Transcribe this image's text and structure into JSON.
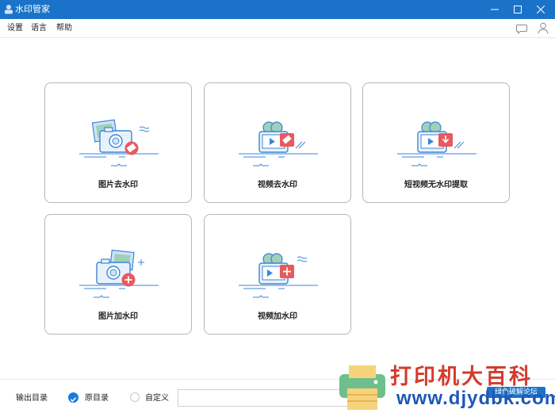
{
  "window": {
    "title": "水印管家"
  },
  "menu": {
    "settings": "设置",
    "language": "语言",
    "help": "帮助"
  },
  "cards": [
    {
      "label": "图片去水印",
      "icon": "image-remove-watermark-icon"
    },
    {
      "label": "视频去水印",
      "icon": "video-remove-watermark-icon"
    },
    {
      "label": "短视频无水印提取",
      "icon": "short-video-extract-icon"
    },
    {
      "label": "图片加水印",
      "icon": "image-add-watermark-icon"
    },
    {
      "label": "视频加水印",
      "icon": "video-add-watermark-icon"
    }
  ],
  "output": {
    "label": "输出目录",
    "option_original": "原目录",
    "option_custom": "自定义",
    "selected": "原目录",
    "path_value": ""
  },
  "watermark": {
    "line1": "打印机大百科",
    "line2": "www.djydbk.com",
    "tag": "绿色破解论坛"
  },
  "colors": {
    "titlebar": "#1a73c9",
    "accent_blue": "#1a7be0",
    "icon_blue": "#3b86d6",
    "icon_light": "#cfe3f7",
    "icon_red": "#e85a5e",
    "icon_green": "#7dbd9e"
  }
}
